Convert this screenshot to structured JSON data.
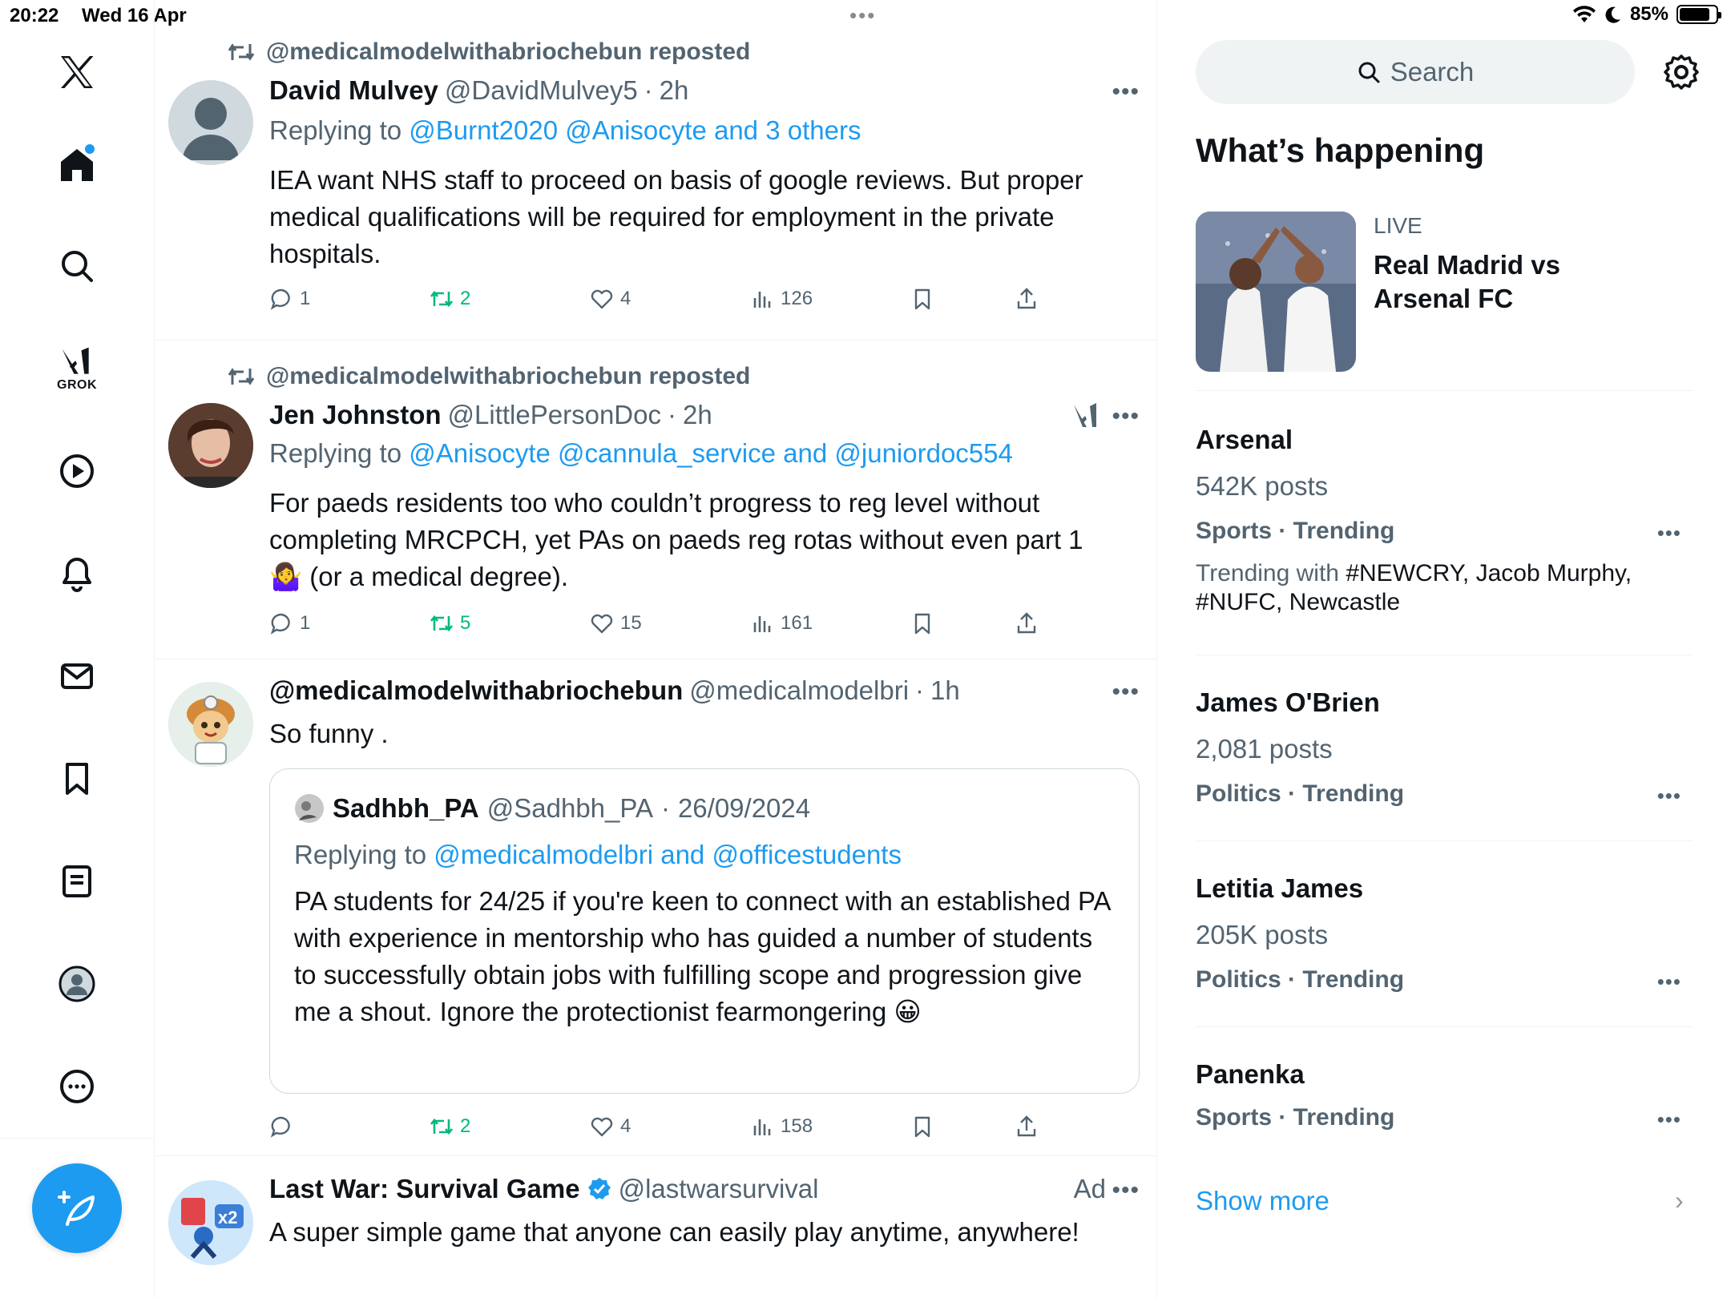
{
  "status_bar": {
    "time": "20:22",
    "date": "Wed 16 Apr",
    "battery": "85%",
    "battery_fraction": 0.85
  },
  "nav": {
    "items": [
      "Home",
      "Search",
      "Grok",
      "Video",
      "Notifications",
      "Messages",
      "Bookmarks",
      "Lists",
      "Profile",
      "More"
    ],
    "grok_label": "GROK"
  },
  "tweets": [
    {
      "repost_by": "@medicalmodelwithabriochebun reposted",
      "name": "David Mulvey",
      "handle": "@DavidMulvey5",
      "sep": "·",
      "time": "2h",
      "replying_prefix": "Replying to",
      "replying_links": "@Burnt2020 @Anisocyte and 3 others",
      "text": "IEA want NHS staff to proceed on basis of google reviews. But proper medical qualifications will be required for employment in the private hospitals.",
      "replies": "1",
      "reposts": "2",
      "likes": "4",
      "views": "126"
    },
    {
      "repost_by": "@medicalmodelwithabriochebun reposted",
      "name": "Jen Johnston",
      "handle": "@LittlePersonDoc",
      "sep": "·",
      "time": "2h",
      "replying_prefix": "Replying to",
      "replying_links": "@Anisocyte @cannula_service and @juniordoc554",
      "text": "For paeds residents too who couldn’t progress to reg level without completing MRCPCH, yet PAs on paeds reg rotas without even part 1 🤷‍♀️ (or a medical degree).",
      "replies": "1",
      "reposts": "5",
      "likes": "15",
      "views": "161"
    },
    {
      "name": "@medicalmodelwithabriochebun",
      "handle": "@medicalmodelbri",
      "sep": "·",
      "time": "1h",
      "text": "So funny .",
      "quote": {
        "name": "Sadhbh_PA",
        "handle": "@Sadhbh_PA",
        "sep": "·",
        "date": "26/09/2024",
        "replying_prefix": "Replying to",
        "replying_links": "@medicalmodelbri and @officestudents",
        "text": "PA students for 24/25 if you're keen to connect with an established PA with experience in mentorship who has guided a number of students to successfully obtain jobs with fulfilling scope and progression give me a shout. Ignore the protectionist fearmongering 😀"
      },
      "replies": "",
      "reposts": "2",
      "likes": "4",
      "views": "158"
    },
    {
      "name": "Last War: Survival Game",
      "handle": "@lastwarsurvival",
      "ad_label": "Ad",
      "text": "A super simple game that anyone can easily play anytime, anywhere!"
    }
  ],
  "sidebar": {
    "search_placeholder": "Search",
    "whats_happening": "What’s happening",
    "live": {
      "label": "LIVE",
      "title": "Real Madrid vs Arsenal FC"
    },
    "trends": [
      {
        "name": "Arsenal",
        "posts": "542K posts",
        "category": "Sports · Trending",
        "trending_with_prefix": "Trending with",
        "trending_with": "#NEWCRY, Jacob Murphy, #NUFC, Newcastle"
      },
      {
        "name": "James O'Brien",
        "posts": "2,081 posts",
        "category": "Politics · Trending"
      },
      {
        "name": "Letitia James",
        "posts": "205K posts",
        "category": "Politics · Trending"
      },
      {
        "name": "Panenka",
        "category": "Sports · Trending"
      }
    ],
    "show_more": "Show more"
  },
  "colors": {
    "accent": "#1d9bf0",
    "repost_green": "#00ba7c",
    "muted": "#536471"
  }
}
